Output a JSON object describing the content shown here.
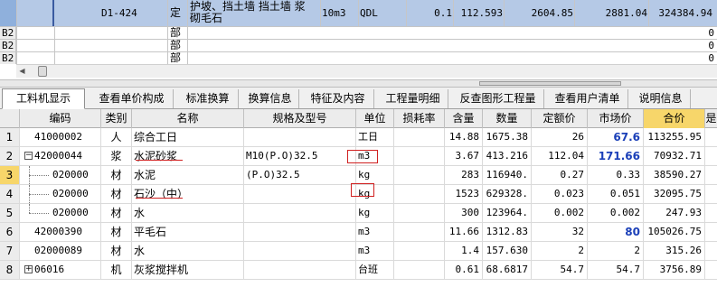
{
  "top_grid": {
    "selected_row": {
      "code": "D1-424",
      "type": "定",
      "name_line1": "护坡、挡土墙 挡土墙 浆",
      "name_line2": "砌毛石",
      "unit": "10m3",
      "qty_expr": "QDL",
      "qty": "0.1",
      "unit_price": "112.593",
      "v1": "2604.85",
      "v2": "2881.04",
      "v3": "324384.94"
    },
    "rows": [
      {
        "code": "B2",
        "type": "部",
        "last": "0"
      },
      {
        "code": "B2",
        "type": "部",
        "last": "0"
      },
      {
        "code": "B2",
        "type": "部",
        "last": "0"
      }
    ]
  },
  "tabs": [
    "工料机显示",
    "查看单价构成",
    "标准换算",
    "换算信息",
    "特征及内容",
    "工程量明细",
    "反查图形工程量",
    "查看用户清单",
    "说明信息"
  ],
  "grid": {
    "headers": [
      "",
      "编码",
      "类别",
      "名称",
      "规格及型号",
      "单位",
      "损耗率",
      "含量",
      "数量",
      "定额价",
      "市场价",
      "合价",
      "是"
    ],
    "rows": [
      {
        "no": "1",
        "code": "41000002",
        "cat": "人",
        "name": "综合工日",
        "spec": "",
        "unit": "工日",
        "loss": "",
        "content": "14.88",
        "qty": "1675.38",
        "quota": "26",
        "market": "67.6",
        "total": "113255.95"
      },
      {
        "no": "2",
        "code": "42000044",
        "cat": "浆",
        "name": "水泥砂浆",
        "spec": "M10(P.O)32.5",
        "unit": "m3",
        "loss": "",
        "content": "3.67",
        "qty": "413.216",
        "quota": "112.04",
        "market": "171.66",
        "total": "70932.71"
      },
      {
        "no": "3",
        "code": "020000",
        "cat": "材",
        "name": "水泥",
        "spec": "(P.O)32.5",
        "unit": "kg",
        "loss": "",
        "content": "283",
        "qty": "116940.",
        "quota": "0.27",
        "market": "0.33",
        "total": "38590.27"
      },
      {
        "no": "4",
        "code": "020000",
        "cat": "材",
        "name": "石沙（中）",
        "spec": "",
        "unit": "kg",
        "loss": "",
        "content": "1523",
        "qty": "629328.",
        "quota": "0.023",
        "market": "0.051",
        "total": "32095.75"
      },
      {
        "no": "5",
        "code": "020000",
        "cat": "材",
        "name": "水",
        "spec": "",
        "unit": "kg",
        "loss": "",
        "content": "300",
        "qty": "123964.",
        "quota": "0.002",
        "market": "0.002",
        "total": "247.93"
      },
      {
        "no": "6",
        "code": "42000390",
        "cat": "材",
        "name": "平毛石",
        "spec": "",
        "unit": "m3",
        "loss": "",
        "content": "11.66",
        "qty": "1312.83",
        "quota": "32",
        "market": "80",
        "total": "105026.75"
      },
      {
        "no": "7",
        "code": "02000089",
        "cat": "材",
        "name": "水",
        "spec": "",
        "unit": "m3",
        "loss": "",
        "content": "1.4",
        "qty": "157.630",
        "quota": "2",
        "market": "2",
        "total": "315.26"
      },
      {
        "no": "8",
        "code": "06016",
        "cat": "机",
        "name": "灰浆搅拌机",
        "spec": "",
        "unit": "台班",
        "loss": "",
        "content": "0.61",
        "qty": "68.6817",
        "quota": "54.7",
        "market": "54.7",
        "total": "3756.89"
      }
    ]
  },
  "colors": {
    "selection": "#b5c9e6",
    "highlight": "#f7d66a",
    "market_bold": "#1a3fb8",
    "annotation": "#d02020"
  }
}
